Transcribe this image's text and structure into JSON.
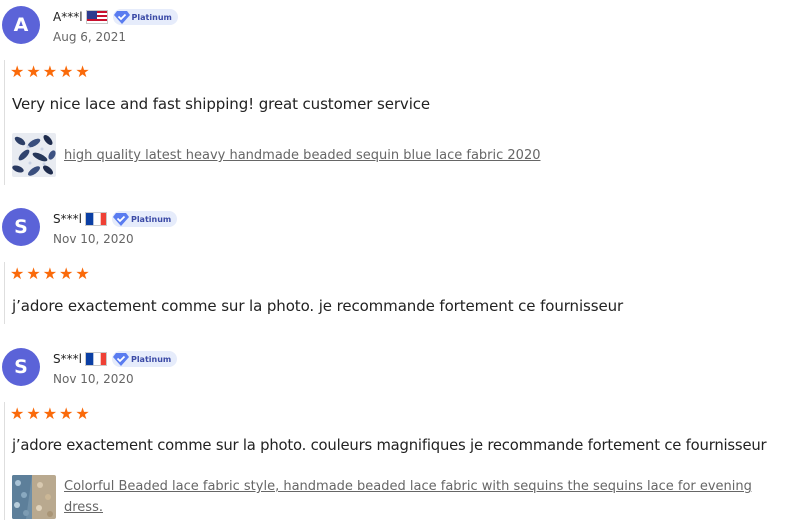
{
  "reviews": [
    {
      "initial": "A",
      "username": "A***l",
      "country": "US",
      "badge": "Platinum",
      "date": "Aug 6, 2021",
      "rating": 5,
      "text": "Very nice lace and fast shipping! great customer service",
      "product": "high quality latest heavy handmade beaded sequin blue lace fabric 2020"
    },
    {
      "initial": "S",
      "username": "S***l",
      "country": "FR",
      "badge": "Platinum",
      "date": "Nov 10, 2020",
      "rating": 5,
      "text": "j’adore exactement comme sur la photo. je recommande fortement ce fournisseur"
    },
    {
      "initial": "S",
      "username": "S***l",
      "country": "FR",
      "badge": "Platinum",
      "date": "Nov 10, 2020",
      "rating": 5,
      "text": "j’adore exactement comme sur la photo. couleurs magnifiques je recommande fortement ce fournisseur",
      "product": "Colorful Beaded lace fabric style, handmade beaded lace fabric with sequins the sequins lace for evening dress."
    }
  ],
  "colors": {
    "avatar": "#5b63d8",
    "star": "#fa6a0a",
    "badge_bg": "#e6ecfb",
    "badge_text": "#3b4aa6",
    "link": "#666666"
  }
}
